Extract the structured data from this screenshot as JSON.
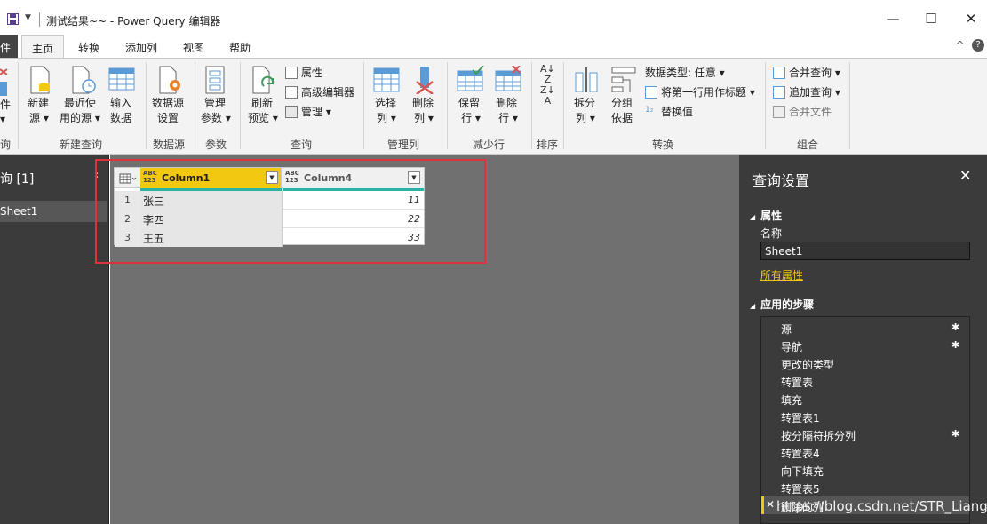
{
  "window": {
    "title": "测试结果~~ - Power Query 编辑器",
    "min": "—",
    "max": "☐",
    "close": "✕"
  },
  "tabs": [
    {
      "label": "件"
    },
    {
      "label": "主页"
    },
    {
      "label": "转换"
    },
    {
      "label": "添加列"
    },
    {
      "label": "视图"
    },
    {
      "label": "帮助"
    }
  ],
  "ribbon": {
    "groups": {
      "g0": "询",
      "new_query": "新建查询",
      "datasource": "数据源",
      "params": "参数",
      "query": "查询",
      "manage_cols": "管理列",
      "reduce_rows": "减少行",
      "sort": "排序",
      "transform": "转换",
      "combine": "组合"
    },
    "buttons": {
      "b0_l1": "件",
      "b0_l2": "▾",
      "new_source_l1": "新建",
      "new_source_l2": "源 ▾",
      "recent_l1": "最近使",
      "recent_l2": "用的源 ▾",
      "enter_l1": "输入",
      "enter_l2": "数据",
      "ds_l1": "数据源",
      "ds_l2": "设置",
      "param_l1": "管理",
      "param_l2": "参数 ▾",
      "refresh_l1": "刷新",
      "refresh_l2": "预览 ▾",
      "properties": "属性",
      "adv_editor": "高级编辑器",
      "manage": "管理 ▾",
      "choose_l1": "选择",
      "choose_l2": "列 ▾",
      "remove_l1": "删除",
      "remove_l2": "列 ▾",
      "keep_l1": "保留",
      "keep_l2": "行 ▾",
      "delrows_l1": "删除",
      "delrows_l2": "行 ▾",
      "split_l1": "拆分",
      "split_l2": "列 ▾",
      "groupby_l1": "分组",
      "groupby_l2": "依据",
      "datatype": "数据类型: 任意 ▾",
      "first_row_header": "将第一行用作标题 ▾",
      "replace_values": "替换值",
      "merge_queries": "合并查询 ▾",
      "append_queries": "追加查询 ▾",
      "combine_files": "合并文件"
    }
  },
  "left_pane": {
    "title": "询 [1]",
    "collapse": "‹",
    "items": [
      {
        "label": "Sheet1"
      }
    ]
  },
  "grid": {
    "columns": [
      {
        "type": "ABC\n123",
        "name": "Column1"
      },
      {
        "type": "ABC\n123",
        "name": "Column4"
      }
    ],
    "rows": [
      {
        "n": "1",
        "c1": "张三",
        "c4": "11"
      },
      {
        "n": "2",
        "c1": "李四",
        "c4": "22"
      },
      {
        "n": "3",
        "c1": "王五",
        "c4": "33"
      }
    ]
  },
  "settings": {
    "title": "查询设置",
    "close": "✕",
    "properties_section": "属性",
    "name_label": "名称",
    "name_value": "Sheet1",
    "all_properties": "所有属性",
    "steps_section": "应用的步骤",
    "steps": [
      {
        "label": "源",
        "gear": true
      },
      {
        "label": "导航",
        "gear": true
      },
      {
        "label": "更改的类型",
        "gear": false
      },
      {
        "label": "转置表",
        "gear": false
      },
      {
        "label": "填充",
        "gear": false
      },
      {
        "label": "转置表1",
        "gear": false
      },
      {
        "label": "按分隔符拆分列",
        "gear": true
      },
      {
        "label": "转置表4",
        "gear": false
      },
      {
        "label": "向下填充",
        "gear": false
      },
      {
        "label": "转置表5",
        "gear": false
      },
      {
        "label": "删除的列",
        "gear": false
      }
    ]
  },
  "watermark": "https://blog.csdn.net/STR_Liang",
  "colors": {
    "accent": "#f2c811",
    "highlight_box": "#e0323a",
    "teal": "#2bb3a3"
  }
}
